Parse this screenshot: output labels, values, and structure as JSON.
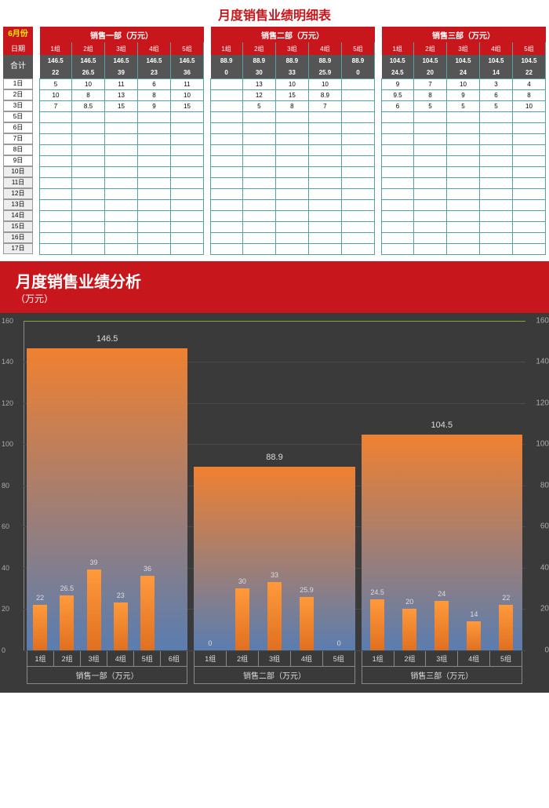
{
  "title": "月度销售业绩明细表",
  "month": "6月份",
  "date_label": "日期",
  "sum_label": "合计",
  "departments": [
    {
      "name": "销售一部（万元）",
      "groups": [
        "1组",
        "2组",
        "3组",
        "4组",
        "5组"
      ],
      "sum_top": [
        "146.5",
        "146.5",
        "146.5",
        "146.5",
        "146.5"
      ],
      "sum_bot": [
        "22",
        "26.5",
        "39",
        "23",
        "36"
      ],
      "rows": [
        [
          "5",
          "10",
          "11",
          "6",
          "11"
        ],
        [
          "10",
          "8",
          "13",
          "8",
          "10"
        ],
        [
          "7",
          "8.5",
          "15",
          "9",
          "15"
        ]
      ]
    },
    {
      "name": "销售二部（万元）",
      "groups": [
        "1组",
        "2组",
        "3组",
        "4组",
        "5组"
      ],
      "sum_top": [
        "88.9",
        "88.9",
        "88.9",
        "88.9",
        "88.9"
      ],
      "sum_bot": [
        "0",
        "30",
        "33",
        "25.9",
        "0"
      ],
      "rows": [
        [
          "",
          "13",
          "10",
          "10",
          ""
        ],
        [
          "",
          "12",
          "15",
          "8.9",
          ""
        ],
        [
          "",
          "5",
          "8",
          "7",
          ""
        ]
      ]
    },
    {
      "name": "销售三部（万元）",
      "groups": [
        "1组",
        "2组",
        "3组",
        "4组",
        "5组"
      ],
      "sum_top": [
        "104.5",
        "104.5",
        "104.5",
        "104.5",
        "104.5"
      ],
      "sum_bot": [
        "24.5",
        "20",
        "24",
        "14",
        "22"
      ],
      "rows": [
        [
          "9",
          "7",
          "10",
          "3",
          "4"
        ],
        [
          "9.5",
          "8",
          "9",
          "6",
          "8"
        ],
        [
          "6",
          "5",
          "5",
          "5",
          "10"
        ]
      ]
    }
  ],
  "dates": [
    "1日",
    "2日",
    "3日",
    "5日",
    "6日",
    "7日",
    "8日",
    "9日",
    "10日",
    "11日",
    "12日",
    "13日",
    "14日",
    "15日",
    "16日",
    "17日"
  ],
  "chart": {
    "title": "月度销售业绩分析",
    "subtitle": "（万元）",
    "y_ticks": [
      0,
      20,
      40,
      60,
      80,
      100,
      120,
      140,
      160
    ],
    "ymax": 160,
    "wide": [
      {
        "label": "146.5",
        "value": 146.5
      },
      {
        "label": "88.9",
        "value": 88.9
      },
      {
        "label": "104.5",
        "value": 104.5
      }
    ],
    "thin": [
      {
        "x_main": "销售一部（万元）",
        "subs": [
          "1组",
          "2组",
          "3组",
          "4组",
          "5组",
          "6组"
        ],
        "v": [
          22,
          26.5,
          39,
          23,
          36,
          null
        ]
      },
      {
        "x_main": "销售二部（万元）",
        "subs": [
          "1组",
          "2组",
          "3组",
          "4组",
          "5组"
        ],
        "v": [
          0,
          30,
          33,
          25.9,
          0
        ]
      },
      {
        "x_main": "销售三部（万元）",
        "subs": [
          "1组",
          "2组",
          "3组",
          "4组",
          "5组"
        ],
        "v": [
          24.5,
          20,
          24,
          14,
          22
        ]
      }
    ]
  },
  "chart_data": [
    {
      "type": "bar",
      "title": "月度销售业绩分析（万元） - 部门总计",
      "categories": [
        "销售一部",
        "销售二部",
        "销售三部"
      ],
      "values": [
        146.5,
        88.9,
        104.5
      ],
      "ylabel": "万元",
      "ylim": [
        0,
        160
      ]
    },
    {
      "type": "bar",
      "title": "月度销售业绩分析（万元） - 各组",
      "series": [
        {
          "name": "销售一部",
          "categories": [
            "1组",
            "2组",
            "3组",
            "4组",
            "5组",
            "6组"
          ],
          "values": [
            22,
            26.5,
            39,
            23,
            36,
            null
          ]
        },
        {
          "name": "销售二部",
          "categories": [
            "1组",
            "2组",
            "3组",
            "4组",
            "5组"
          ],
          "values": [
            0,
            30,
            33,
            25.9,
            0
          ]
        },
        {
          "name": "销售三部",
          "categories": [
            "1组",
            "2组",
            "3组",
            "4组",
            "5组"
          ],
          "values": [
            24.5,
            20,
            24,
            14,
            22
          ]
        }
      ],
      "ylabel": "万元",
      "ylim": [
        0,
        160
      ]
    }
  ]
}
